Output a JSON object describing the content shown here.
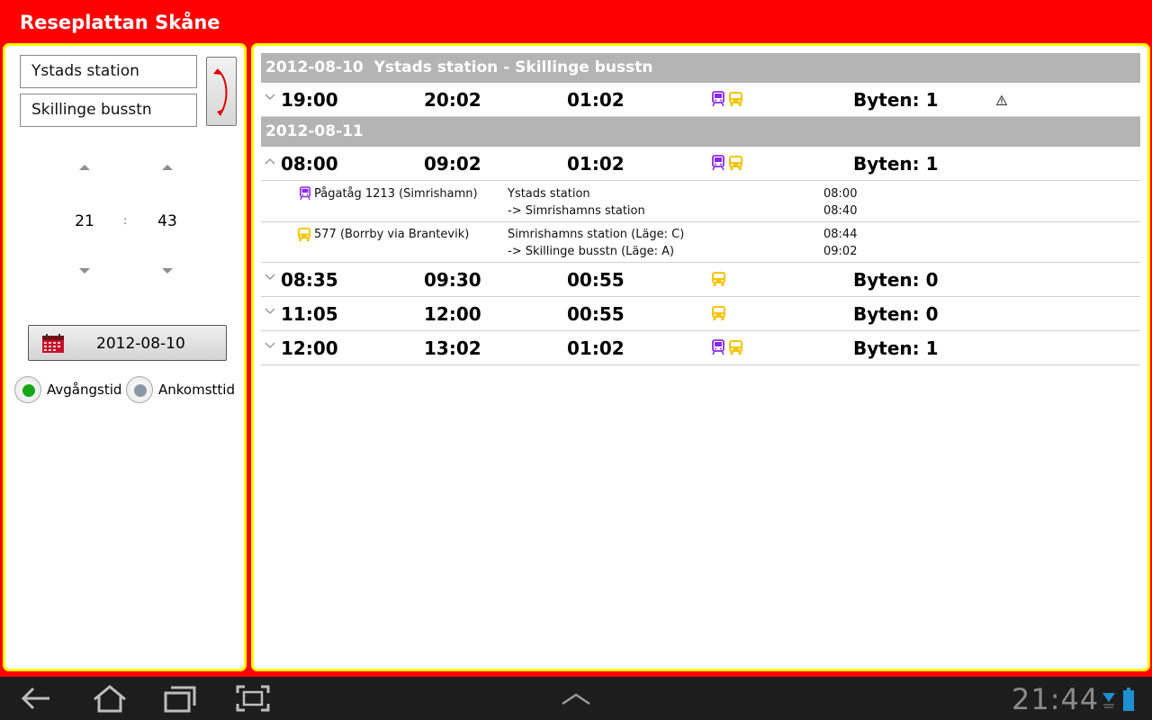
{
  "app": {
    "title": "Reseplattan Skåne"
  },
  "search": {
    "from": "Ystads station",
    "to": "Skillinge busstn",
    "hour": "21",
    "minute": "43",
    "time_separator": ":",
    "date": "2012-08-10",
    "mode_options": [
      {
        "label": "Avgångstid",
        "selected": true
      },
      {
        "label": "Ankomsttid",
        "selected": false
      }
    ]
  },
  "results": {
    "header_date": "2012-08-10",
    "header_route": "Ystads station - Skillinge busstn",
    "trip1": {
      "dep": "19:00",
      "arr": "20:02",
      "dur": "01:02",
      "changes": "Byten: 1",
      "modes": [
        "train-icon",
        "bus-icon"
      ],
      "warning": true
    },
    "date2": "2012-08-11",
    "trip2": {
      "dep": "08:00",
      "arr": "09:02",
      "dur": "01:02",
      "changes": "Byten: 1",
      "modes": [
        "train-icon",
        "bus-icon"
      ],
      "expanded": true
    },
    "leg1": {
      "name": "Pågatåg 1213 (Simrishamn)",
      "from": "Ystads station",
      "to": "-> Simrishamns station",
      "t1": "08:00",
      "t2": "08:40",
      "mode": "train-icon"
    },
    "leg2": {
      "name": "577 (Borrby via Brantevik)",
      "from": "Simrishamns station (Läge: C)",
      "to": "-> Skillinge busstn (Läge: A)",
      "t1": "08:44",
      "t2": "09:02",
      "mode": "bus-icon"
    },
    "trip3": {
      "dep": "08:35",
      "arr": "09:30",
      "dur": "00:55",
      "changes": "Byten: 0",
      "modes": [
        "bus-icon"
      ]
    },
    "trip4": {
      "dep": "11:05",
      "arr": "12:00",
      "dur": "00:55",
      "changes": "Byten: 0",
      "modes": [
        "bus-icon"
      ]
    },
    "trip5": {
      "dep": "12:00",
      "arr": "13:02",
      "dur": "01:02",
      "changes": "Byten: 1",
      "modes": [
        "train-icon",
        "bus-icon"
      ]
    }
  },
  "system": {
    "clock": "21:44"
  },
  "colors": {
    "background": "#ff0000",
    "panel_border": "#ffff00",
    "train": "#8a2be2",
    "bus": "#f5c400",
    "radio_selected": "#17a817",
    "radio_unselected": "#8a98a8"
  }
}
